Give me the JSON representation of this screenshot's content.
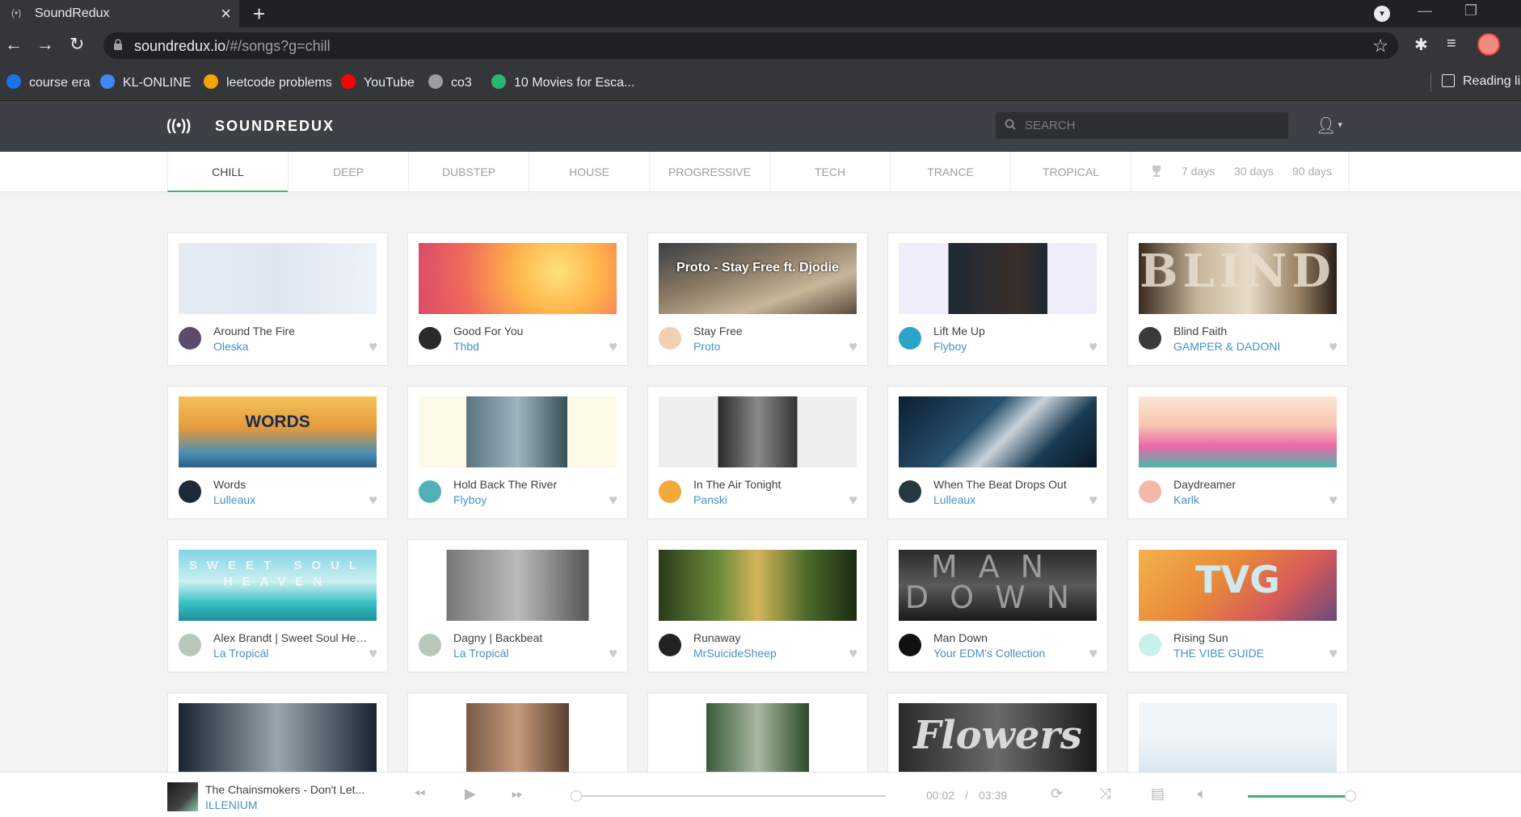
{
  "browser": {
    "tab_title": "SoundRedux",
    "url_host": "soundredux.io",
    "url_path": "/#/songs?g=chill",
    "bookmarks": [
      {
        "label": "course era",
        "icon": "coursera-icon",
        "color": "#1a73e8"
      },
      {
        "label": "KL-ONLINE",
        "icon": "kl-online-icon",
        "color": "#4285f4"
      },
      {
        "label": "leetcode problems",
        "icon": "leetcode-icon",
        "color": "#f0a500"
      },
      {
        "label": "YouTube",
        "icon": "youtube-icon",
        "color": "#ff0000"
      },
      {
        "label": "co3",
        "icon": "co3-icon",
        "color": "#9e9e9e"
      },
      {
        "label": "10 Movies for Esca...",
        "icon": "movies-icon",
        "color": "#2bb673"
      }
    ],
    "reading_list": "Reading list"
  },
  "app": {
    "logo": "SOUNDREDUX",
    "search_placeholder": "SEARCH"
  },
  "genres": {
    "tabs": [
      "CHILL",
      "DEEP",
      "DUBSTEP",
      "HOUSE",
      "PROGRESSIVE",
      "TECH",
      "TRANCE",
      "TROPICAL"
    ],
    "active": "CHILL",
    "time_filters": [
      "7 days",
      "30 days",
      "90 days"
    ]
  },
  "songs": [
    {
      "title": "Around The Fire",
      "artist": "Oleska"
    },
    {
      "title": "Good For You",
      "artist": "Thbd"
    },
    {
      "title": "Stay Free",
      "artist": "Proto",
      "art_text": "Proto - Stay Free ft. Djodie"
    },
    {
      "title": "Lift Me Up",
      "artist": "Flyboy"
    },
    {
      "title": "Blind Faith",
      "artist": "GAMPER & DADONI",
      "art_text": "BLIND"
    },
    {
      "title": "Words",
      "artist": "Lulleaux",
      "art_text": "WORDS"
    },
    {
      "title": "Hold Back The River",
      "artist": "Flyboy"
    },
    {
      "title": "In The Air Tonight",
      "artist": "Panski"
    },
    {
      "title": "When The Beat Drops Out",
      "artist": "Lulleaux"
    },
    {
      "title": "Daydreamer",
      "artist": "Karlk"
    },
    {
      "title": "Alex Brandt | Sweet Soul Hea...",
      "artist": "La Tropicál",
      "art_text": "SWEET SOUL HEAVEN"
    },
    {
      "title": "Dagny | Backbeat",
      "artist": "La Tropicál"
    },
    {
      "title": "Runaway",
      "artist": "MrSuicideSheep"
    },
    {
      "title": "Man Down",
      "artist": "Your EDM's Collection",
      "art_text": "MAN DOWN"
    },
    {
      "title": "Rising Sun",
      "artist": "THE VIBE GUIDE",
      "art_text": "TVG"
    },
    {
      "title": "",
      "artist": ""
    },
    {
      "title": "",
      "artist": ""
    },
    {
      "title": "",
      "artist": ""
    },
    {
      "title": "",
      "artist": "",
      "art_text": "Flowers"
    },
    {
      "title": "",
      "artist": ""
    }
  ],
  "player": {
    "title": "The Chainsmokers - Don't Let...",
    "artist": "ILLENIUM",
    "current_time": "00:02",
    "separator": "/",
    "duration": "03:39",
    "progress": 0.01,
    "volume": 1.0
  },
  "colors": {
    "accent": "#3cb371",
    "link": "#4a90c8",
    "header": "#3d4147"
  }
}
